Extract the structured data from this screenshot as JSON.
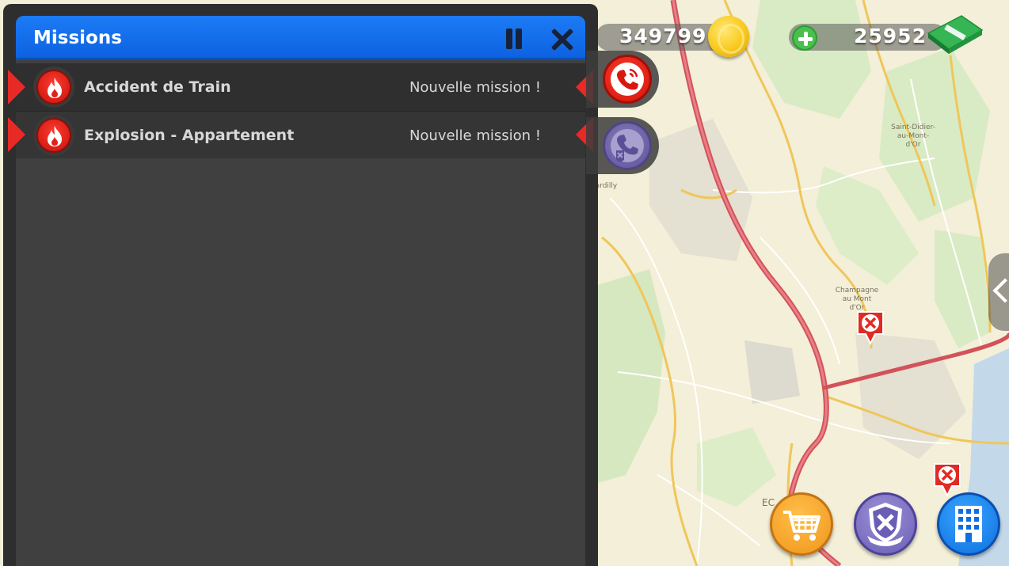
{
  "map": {
    "labels": [
      {
        "id": "saint-didier",
        "text": "Saint-Didier-\nau-Mont-\nd'Or"
      },
      {
        "id": "champagne",
        "text": "Champagne\nau Mont\nd'Or"
      },
      {
        "id": "dardilly",
        "text": "Dardilly"
      },
      {
        "id": "ec",
        "text": "EC"
      }
    ]
  },
  "currency": {
    "coins": "349799",
    "cash": "25952"
  },
  "missions_panel": {
    "title": "Missions",
    "missions": [
      {
        "name": "Accident de Train",
        "status": "Nouvelle mission !"
      },
      {
        "name": "Explosion - Appartement",
        "status": "Nouvelle mission !"
      }
    ]
  },
  "colors": {
    "header_blue": "#0d62e0",
    "mission_red": "#e72a26",
    "panel_dark": "#404040",
    "coin_gold": "#f8c91c",
    "plus_green": "#49c04d"
  },
  "icons": {
    "pause": "pause-icon",
    "close": "close-icon",
    "mission_type": "fire-icon",
    "call_emergency": "phone-icon",
    "call_guild": "guild-phone-icon",
    "shop": "shopping-cart-icon",
    "guild": "guild-shield-icon",
    "buildings": "building-icon"
  }
}
